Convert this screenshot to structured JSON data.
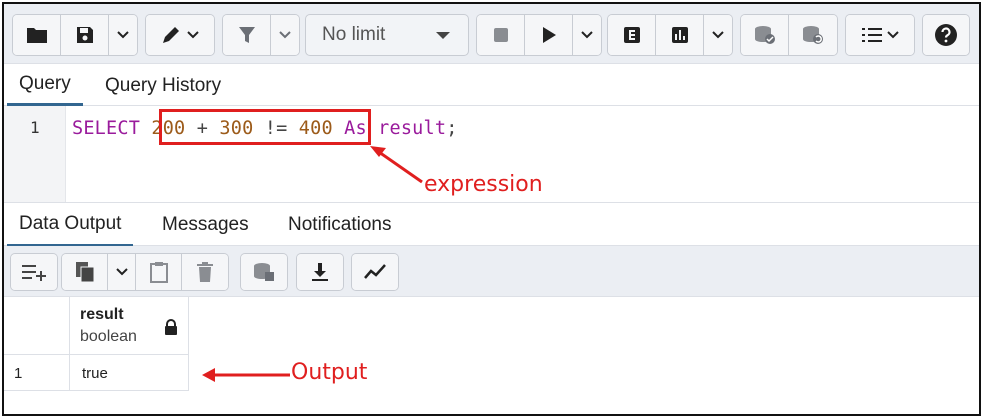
{
  "toolbar": {
    "limit_value": "No limit",
    "icons": [
      "folder-icon",
      "save-icon",
      "chevron-down-icon",
      "pen-icon",
      "filter-icon",
      "stop-icon",
      "play-icon",
      "explain-icon",
      "explain-analyze-icon",
      "commit-icon",
      "rollback-icon",
      "macros-icon",
      "help-icon"
    ]
  },
  "query_tabs": [
    {
      "label": "Query",
      "active": true
    },
    {
      "label": "Query History",
      "active": false
    }
  ],
  "editor": {
    "line_number": "1",
    "tokens": {
      "select": "SELECT",
      "n1": "200",
      "plus": " + ",
      "n2": "300",
      "neq": " != ",
      "n3": "400",
      "as": "As",
      "alias": "result",
      "semi": ";"
    }
  },
  "annotations": {
    "expression": "expression",
    "output": "Output",
    "color": "#e01f1f"
  },
  "output_tabs": [
    {
      "label": "Data Output",
      "active": true
    },
    {
      "label": "Messages",
      "active": false
    },
    {
      "label": "Notifications",
      "active": false
    }
  ],
  "grid": {
    "columns": [
      {
        "name": "result",
        "type": "boolean"
      }
    ],
    "rows": [
      {
        "num": "1",
        "values": [
          "true"
        ]
      }
    ]
  },
  "colors": {
    "keyword": "#9a1b9c",
    "number": "#9c5b1a",
    "active_tab": "#326690"
  }
}
